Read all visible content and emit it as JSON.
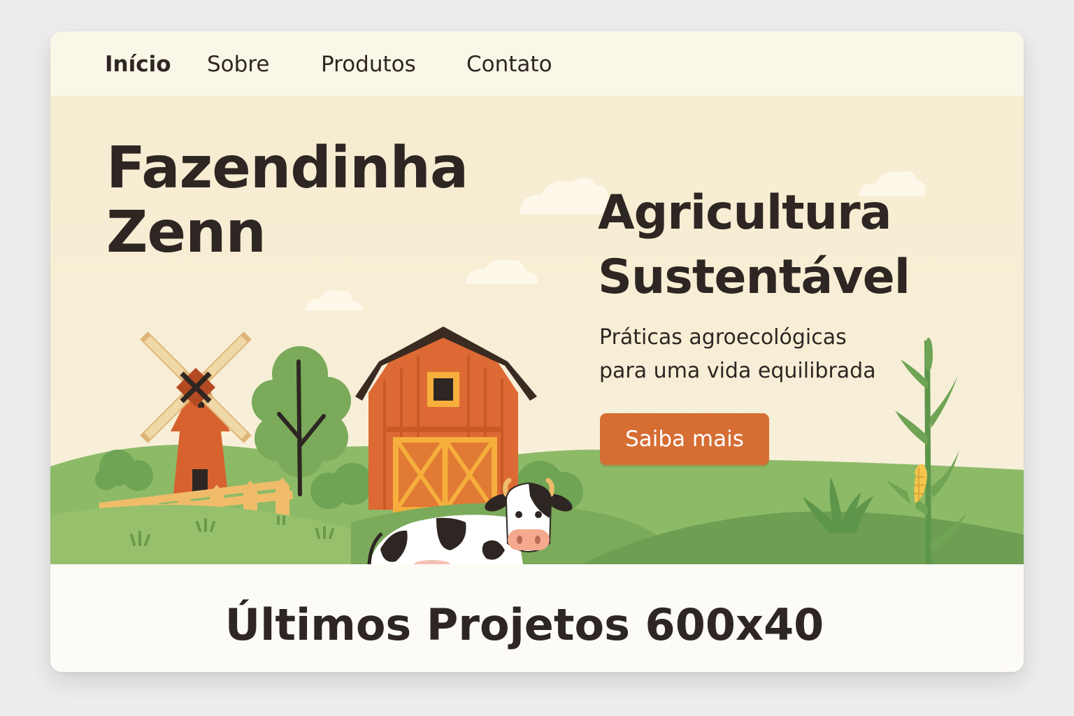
{
  "nav": {
    "items": [
      {
        "label": "Início",
        "active": true
      },
      {
        "label": "Sobre",
        "active": false
      },
      {
        "label": "Produtos",
        "active": false
      },
      {
        "label": "Contato",
        "active": false
      }
    ]
  },
  "hero": {
    "title_line1": "Fazendinha",
    "title_line2": "Zenn",
    "tagline_line1": "Agricultura",
    "tagline_line2": "Sustentável",
    "subtitle_line1": "Práticas agroecológicas",
    "subtitle_line2": "para uma vida equilibrada",
    "cta_label": "Saiba mais"
  },
  "projects": {
    "title": "Últimos Projetos 600x40"
  },
  "colors": {
    "accent": "#d66e34",
    "background": "#f6edd4",
    "nav_background": "#faf6e8",
    "text": "#2e2622",
    "hill_green": "#7aaa5a"
  },
  "illustration": {
    "elements": [
      "windmill",
      "fence",
      "tree",
      "barn",
      "cow",
      "corn-plant",
      "grass",
      "clouds",
      "hills"
    ]
  }
}
